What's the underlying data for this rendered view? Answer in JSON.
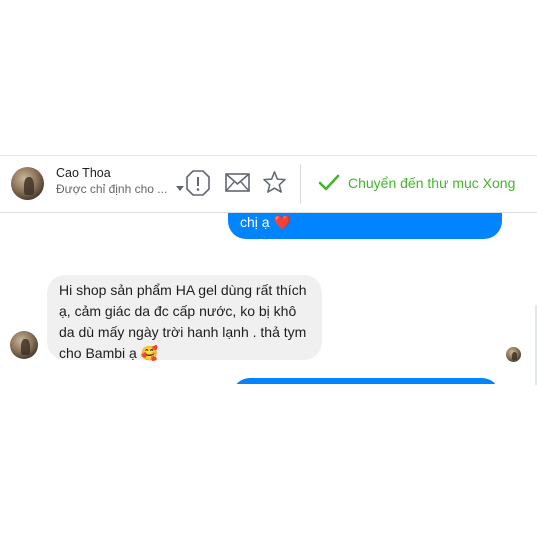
{
  "conversation": {
    "contact_name": "Cao Thoa",
    "assigned_status": "Được chỉ định cho ...",
    "move_to_done_label": "Chuyển đến thư mục Xong"
  },
  "icons": {
    "spam": "exclamation-octagon-icon",
    "mark_unread": "envelope-icon",
    "star": "star-icon",
    "done": "checkmark-icon"
  },
  "messages": {
    "outgoing_partial_text": "chị ạ ❤️",
    "incoming_lines": [
      "Hi shop sản phẩm HA gel dùng rất thích",
      "ạ, cảm giác da đc cấp nước, ko bị khô",
      "da dù mấy ngày trời hanh lạnh . thả tym",
      "cho Bambi ạ 🥰"
    ]
  },
  "colors": {
    "outgoing_bubble": "#0084ff",
    "incoming_bubble": "#f0f0f0",
    "done_green": "#42b72a"
  }
}
